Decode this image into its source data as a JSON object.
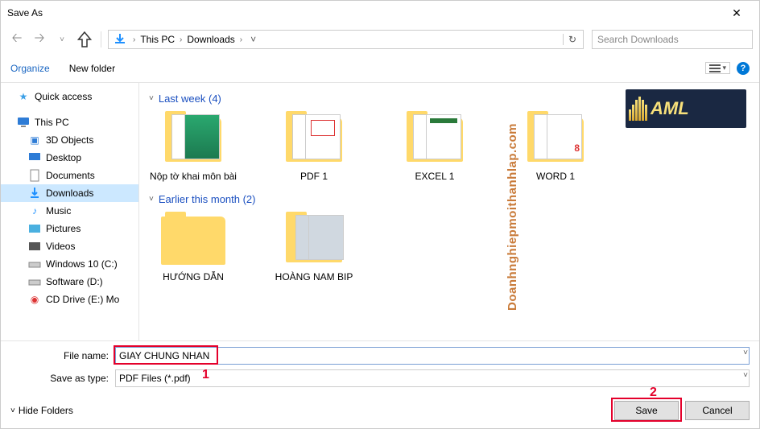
{
  "window": {
    "title": "Save As"
  },
  "breadcrumb": {
    "root": "This PC",
    "current": "Downloads"
  },
  "search": {
    "placeholder": "Search Downloads"
  },
  "toolbar": {
    "organize": "Organize",
    "newfolder": "New folder"
  },
  "sidebar": {
    "quick": "Quick access",
    "thispc": "This PC",
    "items": [
      {
        "label": "3D Objects"
      },
      {
        "label": "Desktop"
      },
      {
        "label": "Documents"
      },
      {
        "label": "Downloads"
      },
      {
        "label": "Music"
      },
      {
        "label": "Pictures"
      },
      {
        "label": "Videos"
      },
      {
        "label": "Windows 10 (C:)"
      },
      {
        "label": "Software (D:)"
      },
      {
        "label": "CD Drive (E:) Mo"
      }
    ]
  },
  "groups": {
    "lastweek": {
      "header": "Last week (4)",
      "items": [
        "Nộp tờ khai môn bài",
        "PDF 1",
        "EXCEL 1",
        "WORD 1"
      ]
    },
    "earlier": {
      "header": "Earlier this month (2)",
      "items": [
        "HƯỚNG DẪN",
        "HOÀNG NAM BIP"
      ]
    }
  },
  "footer": {
    "filename_label": "File name:",
    "filename_value": "GIAY CHUNG NHAN",
    "savetype_label": "Save as type:",
    "savetype_value": "PDF Files (*.pdf)",
    "hide": "Hide Folders",
    "save": "Save",
    "cancel": "Cancel"
  },
  "markers": {
    "m1": "1",
    "m2": "2"
  },
  "watermark": "Doanhnghiepmoithanhlap.com",
  "logo": {
    "text": "AML"
  }
}
